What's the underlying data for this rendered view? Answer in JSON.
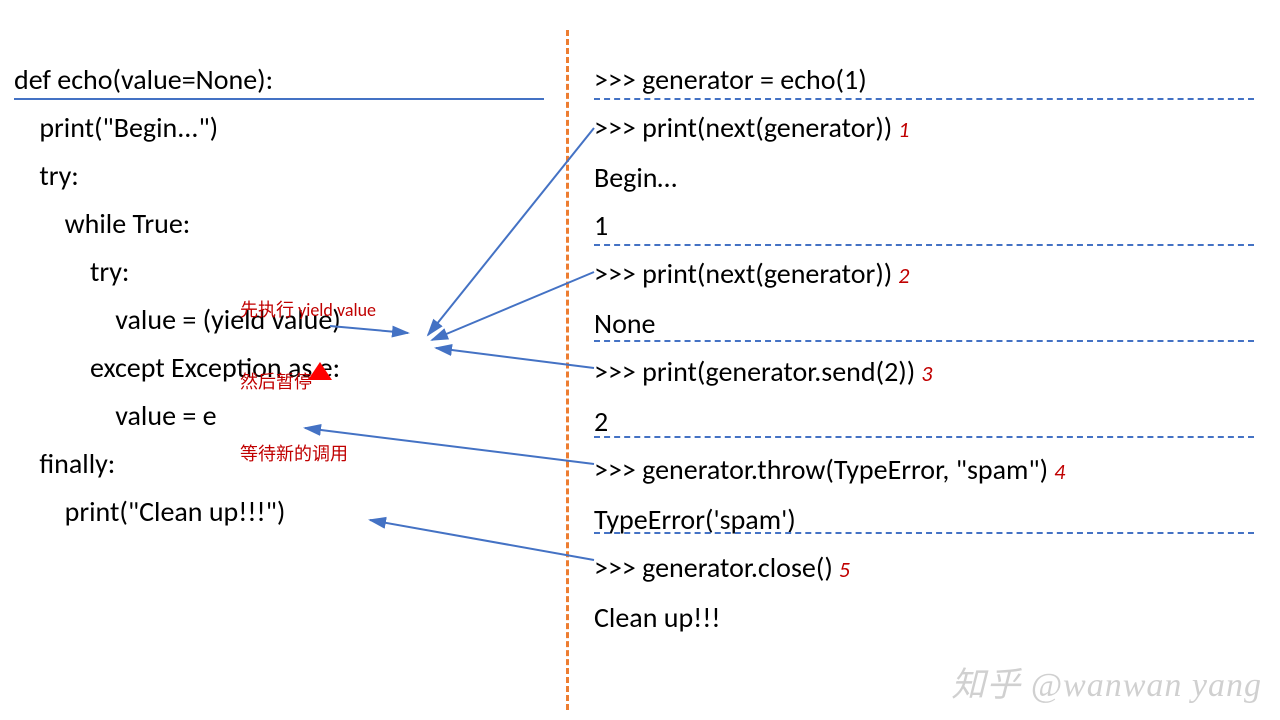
{
  "left": {
    "lines": [
      "def echo(value=None):",
      "    print(\"Begin...\")",
      "    try:",
      "        while True:",
      "            try:",
      "                value = (yield value)",
      "            except Exception as e:",
      "                value = e",
      "    finally:",
      "        print(\"Clean up!!!\")"
    ]
  },
  "annotation": {
    "l1": "先执行 yield value",
    "l2": "然后暂停",
    "l3": "等待新的调用"
  },
  "right": {
    "r0": ">>> generator = echo(1)",
    "r1": ">>> print(next(generator))",
    "s1": "1",
    "r2": "Begin…",
    "r3": "1",
    "r4": ">>> print(next(generator))",
    "s2": "2",
    "r5": "None",
    "r6": ">>> print(generator.send(2))",
    "s3": "3",
    "r7": "2",
    "r8": ">>> generator.throw(TypeError, \"spam\")",
    "s4": "4",
    "r9": "TypeError('spam')",
    "r10": ">>> generator.close()",
    "s5": "5",
    "r11": "Clean up!!!"
  },
  "watermark": "知乎 @wanwan yang"
}
